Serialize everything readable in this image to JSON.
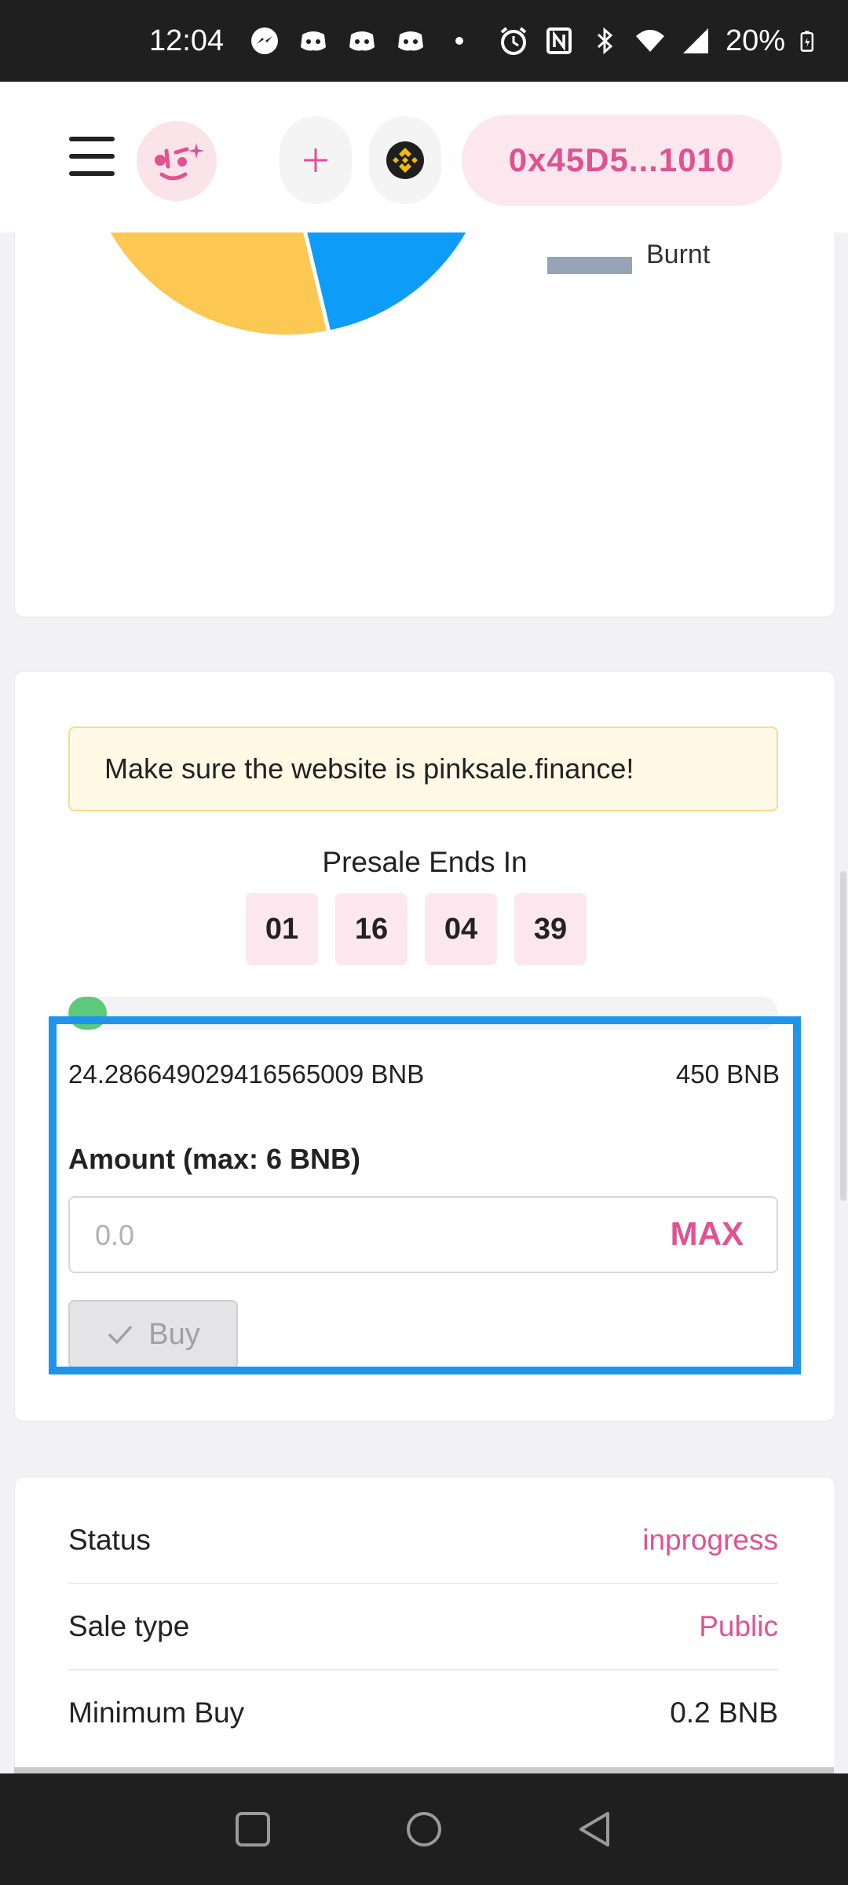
{
  "status_bar": {
    "time": "12:04",
    "battery": "20%",
    "left_icons": [
      "messenger-icon",
      "discord-icon",
      "discord-icon",
      "discord-icon",
      "dot-icon"
    ],
    "right_icons": [
      "alarm-icon",
      "nfc-icon",
      "bluetooth-icon",
      "wifi-icon",
      "signal-icon",
      "battery-icon"
    ]
  },
  "header": {
    "menu_icon": "hamburger-icon",
    "logo_icon": "pinksale-face-icon",
    "add_icon": "plus-icon",
    "chain_icon": "bnb-icon",
    "wallet_address": "0x45D5...1010"
  },
  "chart_card": {
    "legend_label": "Burnt",
    "colors": {
      "yellow": "#fdc851",
      "blue": "#0d9cf7",
      "pink": "#f67399",
      "gray": "#97a3b6"
    }
  },
  "buy_card": {
    "notice": "Make sure the website is pinksale.finance!",
    "presale_title": "Presale Ends In",
    "countdown": [
      "01",
      "16",
      "04",
      "39"
    ],
    "progress_percent": 5.4,
    "raised": "24.286649029416565009 BNB",
    "hard_cap": "450 BNB",
    "amount_label": "Amount (max: 6 BNB)",
    "amount_placeholder": "0.0",
    "max_label": "MAX",
    "buy_label": "Buy",
    "buy_icon": "check-icon"
  },
  "info_card": {
    "rows": [
      {
        "label": "Status",
        "value": "inprogress"
      },
      {
        "label": "Sale type",
        "value": "Public"
      },
      {
        "label": "Minimum Buy",
        "value": "0.2 BNB"
      }
    ]
  },
  "colors": {
    "accent_pink": "#e05292",
    "highlight_blue": "#1e95ea",
    "progress_green": "#5cc97b"
  },
  "nav_bar": {
    "buttons": [
      "recents-square-icon",
      "home-circle-icon",
      "back-triangle-icon"
    ]
  }
}
